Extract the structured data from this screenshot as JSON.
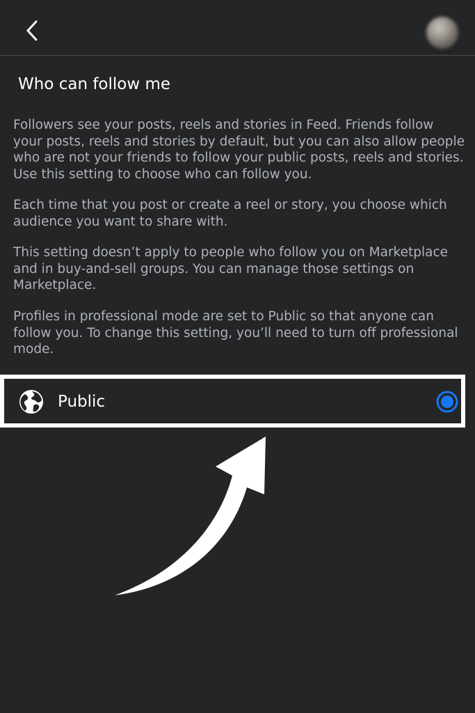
{
  "header": {
    "back_icon": "chevron-left-icon",
    "avatar": "profile-avatar"
  },
  "page": {
    "title": "Who can follow me",
    "paragraphs": [
      "Followers see your posts, reels and stories in Feed. Friends follow your posts, reels and stories by default, but you can also allow people who are not your friends to follow your public posts, reels and stories. Use this setting to choose who can follow you.",
      "Each time that you post or create a reel or story, you choose which audience you want to share with.",
      "This setting doesn’t apply to people who follow you on Marketplace and in buy-and-sell groups. You can manage those settings on Marketplace.",
      "Profiles in professional mode are set to Public so that anyone can follow you. To change this setting, you’ll need to turn off professional mode."
    ]
  },
  "options": [
    {
      "label": "Public",
      "icon": "globe-icon",
      "selected": true
    }
  ],
  "colors": {
    "background": "#242526",
    "accent": "#1877f2",
    "highlight_border": "#ffffff"
  }
}
